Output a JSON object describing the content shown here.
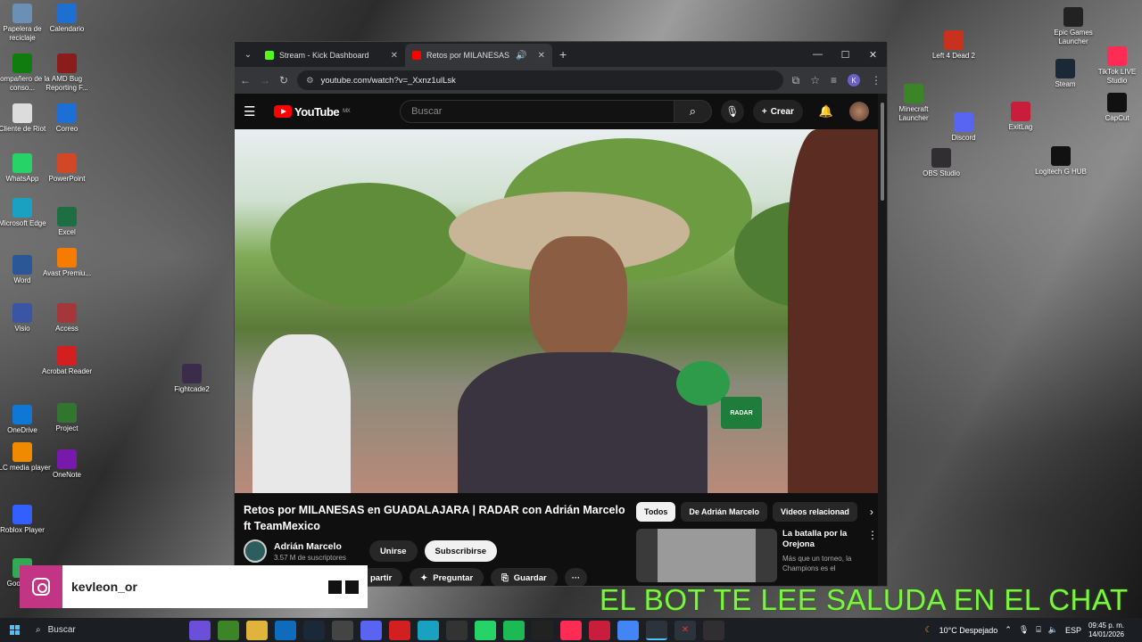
{
  "desktop": {
    "icons_left": [
      {
        "label": "Papelera de reciclaje",
        "icon": "recycle-bin-icon",
        "color": "#6b8fb5"
      },
      {
        "label": "Calendario",
        "icon": "calendar-icon",
        "color": "#1f6fd0"
      },
      {
        "label": "Compañero de la conso...",
        "icon": "xbox-companion-icon",
        "color": "#107c10"
      },
      {
        "label": "AMD Bug Reporting F...",
        "icon": "winrar-icon",
        "color": "#8a1c1c"
      },
      {
        "label": "Cliente de Riot",
        "icon": "document-icon",
        "color": "#dcdcdc"
      },
      {
        "label": "Correo",
        "icon": "mail-icon",
        "color": "#1d6fd6"
      },
      {
        "label": "WhatsApp",
        "icon": "whatsapp-icon",
        "color": "#25d366"
      },
      {
        "label": "PowerPoint",
        "icon": "powerpoint-icon",
        "color": "#d24726"
      },
      {
        "label": "Microsoft Edge",
        "icon": "edge-icon",
        "color": "#1aa0c0"
      },
      {
        "label": "Excel",
        "icon": "excel-icon",
        "color": "#1d6f42"
      },
      {
        "label": "Word",
        "icon": "word-icon",
        "color": "#2b5797"
      },
      {
        "label": "Avast Premiu...",
        "icon": "avast-icon",
        "color": "#f57c00"
      },
      {
        "label": "Visio",
        "icon": "visio-icon",
        "color": "#3955a3"
      },
      {
        "label": "Access",
        "icon": "access-icon",
        "color": "#a4373a"
      },
      {
        "label": "Acrobat Reader",
        "icon": "acrobat-icon",
        "color": "#d21f1f"
      },
      {
        "label": "Fightcade2",
        "icon": "fightcade-icon",
        "color": "#3a2c4a"
      },
      {
        "label": "OneDrive",
        "icon": "onedrive-icon",
        "color": "#0f78d4"
      },
      {
        "label": "Project",
        "icon": "project-icon",
        "color": "#31752f"
      },
      {
        "label": "VLC media player",
        "icon": "vlc-icon",
        "color": "#f08a00"
      },
      {
        "label": "OneNote",
        "icon": "onenote-icon",
        "color": "#7719aa"
      },
      {
        "label": "Roblox Player",
        "icon": "roblox-icon",
        "color": "#335fff"
      },
      {
        "label": "Goog Jue",
        "icon": "google-games-icon",
        "color": "#34a853"
      }
    ],
    "icons_right": [
      {
        "label": "Epic Games Launcher",
        "icon": "epic-games-icon",
        "color": "#222222"
      },
      {
        "label": "Left 4 Dead 2",
        "icon": "left4dead-icon",
        "color": "#c8311e"
      },
      {
        "label": "TikTok LIVE Studio",
        "icon": "tiktok-live-icon",
        "color": "#fe2c55"
      },
      {
        "label": "Steam",
        "icon": "steam-icon",
        "color": "#1b2838"
      },
      {
        "label": "Minecraft Launcher",
        "icon": "minecraft-icon",
        "color": "#3c8527"
      },
      {
        "label": "CapCut",
        "icon": "capcut-icon",
        "color": "#111111"
      },
      {
        "label": "Discord",
        "icon": "discord-icon",
        "color": "#5865f2"
      },
      {
        "label": "ExitLag",
        "icon": "exitlag-icon",
        "color": "#c81e3c"
      },
      {
        "label": "OBS Studio",
        "icon": "obs-icon",
        "color": "#302e31"
      },
      {
        "label": "Logitech G HUB",
        "icon": "logitech-icon",
        "color": "#111111"
      }
    ]
  },
  "browser": {
    "tabs": [
      {
        "title": "Stream - Kick Dashboard",
        "fav_color": "#53fc18"
      },
      {
        "title": "Retos por MILANESAS en G",
        "fav_color": "#ff0000"
      }
    ],
    "url": "youtube.com/watch?v=_Xxnz1ulLsk",
    "profile_initial": "K"
  },
  "youtube": {
    "logo_text": "YouTube",
    "region": "MX",
    "search_placeholder": "Buscar",
    "create_label": "Crear",
    "video_title": "Retos por MILANESAS en GUADALAJARA | RADAR con Adrián Marcelo ft TeamMexico",
    "channel_name": "Adrián Marcelo",
    "subscribers": "3.57 M de suscriptores",
    "join_label": "Unirse",
    "subscribe_label": "Subscribirse",
    "share_label": "partir",
    "ask_label": "Preguntar",
    "save_label": "Guardar",
    "more_label": "···",
    "chips": [
      "Todos",
      "De Adrián Marcelo",
      "Videos relacionad"
    ],
    "rec_title": "La batalla por la Orejona",
    "rec_desc": "Más que un torneo, la Champions es el",
    "mic_text": "RADAR"
  },
  "overlay": {
    "instagram_user": "kevleon_or",
    "bot_message": "EL BOT TE LEE SALUDA EN EL CHAT"
  },
  "taskbar": {
    "search_label": "Buscar",
    "weather": "10°C  Despejado",
    "language": "ESP",
    "time": "09:45 p. m.",
    "date": "14/01/2026"
  }
}
